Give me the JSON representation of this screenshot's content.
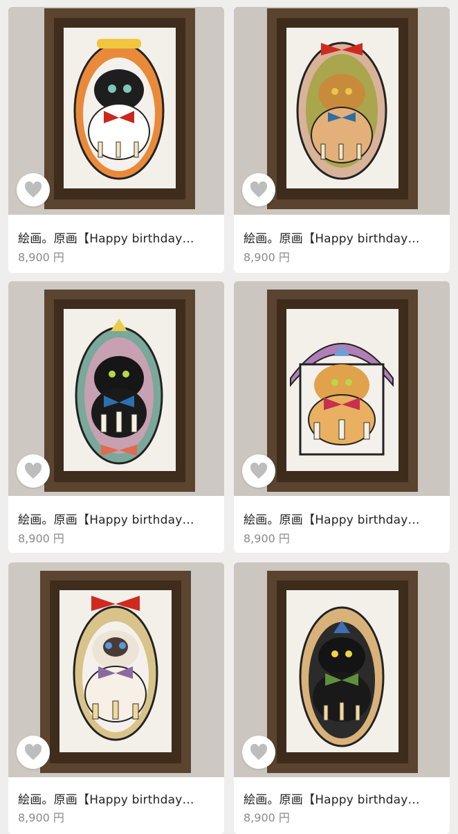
{
  "listings": [
    {
      "title": "絵画。原画【Happy birthday…",
      "price": "8,900 円",
      "cat": "tuxedo"
    },
    {
      "title": "絵画。原画【Happy birthday…",
      "price": "8,900 円",
      "cat": "tabby"
    },
    {
      "title": "絵画。原画【Happy birthday…",
      "price": "8,900 円",
      "cat": "black"
    },
    {
      "title": "絵画。原画【Happy birthday…",
      "price": "8,900 円",
      "cat": "orange"
    },
    {
      "title": "絵画。原画【Happy birthday…",
      "price": "8,900 円",
      "cat": "siamese"
    },
    {
      "title": "絵画。原画【Happy birthday…",
      "price": "8,900 円",
      "cat": "black-hat"
    }
  ],
  "favorite_icon": "heart-icon"
}
